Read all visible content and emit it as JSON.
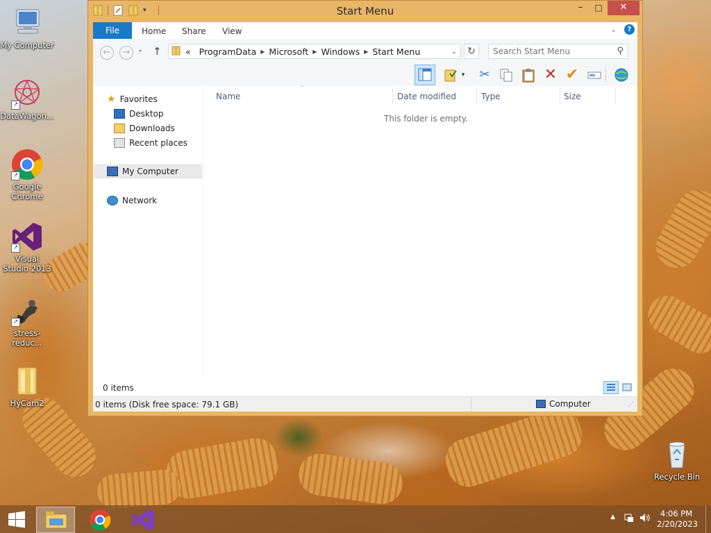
{
  "desktop": {
    "icons": [
      {
        "label": "My Computer",
        "icon": "computer-icon"
      },
      {
        "label": "DataWagon...",
        "icon": "datawagon-icon"
      },
      {
        "label": "Google Chrome",
        "icon": "chrome-icon"
      },
      {
        "label": "Visual Studio 2013",
        "icon": "visual-studio-icon"
      },
      {
        "label": "stress-reduc...",
        "icon": "stress-reducer-icon"
      },
      {
        "label": "HyCam2",
        "icon": "folder-icon"
      },
      {
        "label": "Recycle Bin",
        "icon": "recycle-bin-icon"
      }
    ]
  },
  "window": {
    "title": "Start Menu",
    "buttons": {
      "minimize": "–",
      "maximize": "□",
      "close": "✕"
    },
    "ribbon": {
      "file": "File",
      "tabs": [
        "Home",
        "Share",
        "View"
      ]
    },
    "address": {
      "prefix": "«",
      "crumbs": [
        "ProgramData",
        "Microsoft",
        "Windows",
        "Start Menu"
      ]
    },
    "search": {
      "placeholder": "Search Start Menu"
    },
    "nav": {
      "favorites": "Favorites",
      "desktop": "Desktop",
      "downloads": "Downloads",
      "recent": "Recent places",
      "computer": "My Computer",
      "network": "Network"
    },
    "columns": [
      "Name",
      "Date modified",
      "Type",
      "Size"
    ],
    "empty_message": "This folder is empty.",
    "item_count": "0 items",
    "status": "0 items (Disk free space: 79.1 GB)",
    "status_location": "Computer"
  },
  "taskbar": {
    "time": "4:06 PM",
    "date": "2/20/2023"
  }
}
